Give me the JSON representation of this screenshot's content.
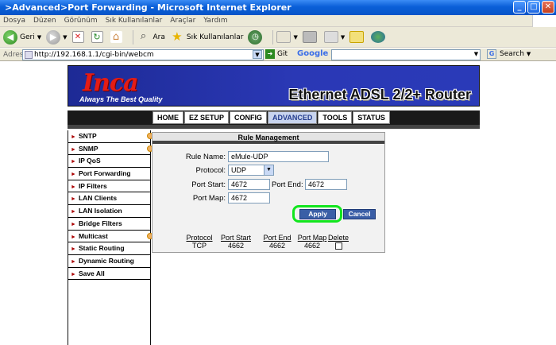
{
  "window": {
    "title": ">Advanced>Port Forwarding - Microsoft Internet Explorer",
    "minimize": "_",
    "maximize": "□",
    "close": "✕"
  },
  "menu": [
    "Dosya",
    "Düzen",
    "Görünüm",
    "Sık Kullanılanlar",
    "Araçlar",
    "Yardım"
  ],
  "toolbar": {
    "back_label": "Geri",
    "search_label": "Ara",
    "favorites_label": "Sık Kullanılanlar"
  },
  "address": {
    "label": "Adres",
    "url": "http://192.168.1.1/cgi-bin/webcm",
    "go_label": "Git",
    "google_label": "Google",
    "search_label": "Search"
  },
  "router": {
    "logo": "Inca",
    "tagline": "Always The Best Quality",
    "title": "Ethernet ADSL 2/2+ Router"
  },
  "nav": [
    "HOME",
    "EZ SETUP",
    "CONFIG",
    "ADVANCED",
    "TOOLS",
    "STATUS"
  ],
  "nav_active": "ADVANCED",
  "sidebar": [
    {
      "label": "SNTP",
      "dot": true
    },
    {
      "label": "SNMP",
      "dot": true
    },
    {
      "label": "IP QoS",
      "dot": false
    },
    {
      "label": "Port Forwarding",
      "dot": false
    },
    {
      "label": "IP Filters",
      "dot": false
    },
    {
      "label": "LAN Clients",
      "dot": false
    },
    {
      "label": "LAN Isolation",
      "dot": false
    },
    {
      "label": "Bridge Filters",
      "dot": false
    },
    {
      "label": "Multicast",
      "dot": true
    },
    {
      "label": "Static Routing",
      "dot": false
    },
    {
      "label": "Dynamic Routing",
      "dot": false
    },
    {
      "label": "Save All",
      "dot": false
    }
  ],
  "rule": {
    "heading": "Rule Management",
    "name_label": "Rule Name:",
    "name_value": "eMule-UDP",
    "protocol_label": "Protocol:",
    "protocol_value": "UDP",
    "port_start_label": "Port Start:",
    "port_start_value": "4672",
    "port_end_label": "Port End:",
    "port_end_value": "4672",
    "port_map_label": "Port Map:",
    "port_map_value": "4672",
    "apply_label": "Apply",
    "cancel_label": "Cancel"
  },
  "rules_table": {
    "headers": [
      "Protocol",
      "Port Start",
      "Port End",
      "Port Map",
      "Delete"
    ],
    "rows": [
      {
        "protocol": "TCP",
        "port_start": "4662",
        "port_end": "4662",
        "port_map": "4662"
      }
    ]
  },
  "colors": {
    "titlebar": "#0a5fd8",
    "banner": "#2a38b5",
    "logo": "#e51c14",
    "button": "#3a5ea6",
    "highlight_ring": "#12e61e"
  }
}
